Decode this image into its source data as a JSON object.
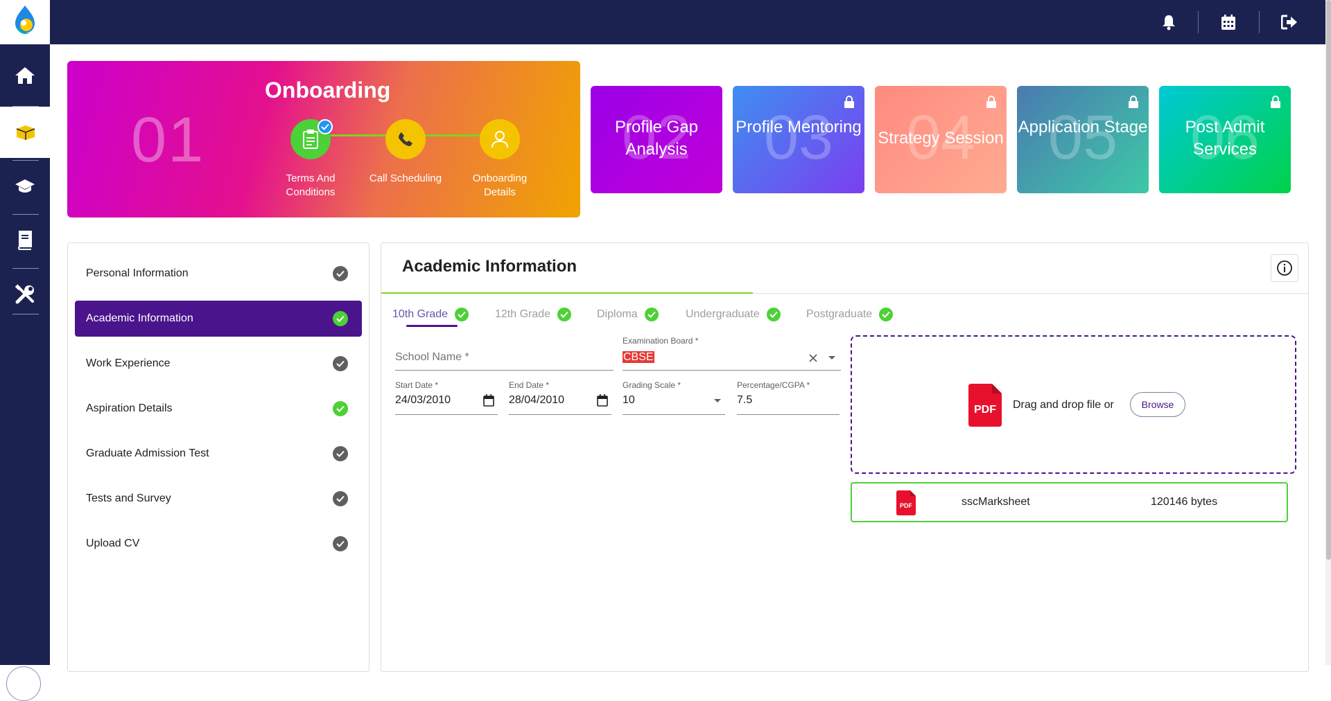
{
  "topbar": {
    "icons": [
      "bell-icon",
      "calendar-icon",
      "logout-icon"
    ]
  },
  "sidebar": {
    "items": [
      "home-icon",
      "onboarding-box-icon",
      "graduation-cap-icon",
      "book-icon",
      "tools-icon"
    ],
    "active_index": 1,
    "expand_icon": "chevron-right-icon"
  },
  "onboarding": {
    "number": "01",
    "title": "Onboarding",
    "steps": [
      {
        "label": "Terms And Conditions",
        "icon": "clipboard-icon",
        "done": true
      },
      {
        "label": "Call Scheduling",
        "icon": "phone-icon",
        "done": false
      },
      {
        "label": "Onboarding Details",
        "icon": "user-icon",
        "done": false
      }
    ],
    "colors": {
      "step1": "#4cd137",
      "step2": "#f5c400",
      "step3": "#f5c400",
      "connector": "#7ed321"
    }
  },
  "stages": [
    {
      "num": "02",
      "label": "Profile Gap Analysis",
      "locked": false
    },
    {
      "num": "03",
      "label": "Profile Mentoring",
      "locked": true
    },
    {
      "num": "04",
      "label": "Strategy Session",
      "locked": true
    },
    {
      "num": "05",
      "label": "Application Stage",
      "locked": true
    },
    {
      "num": "06",
      "label": "Post Admit Services",
      "locked": true
    }
  ],
  "nav": {
    "items": [
      {
        "label": "Personal Information",
        "status": "complete-grey"
      },
      {
        "label": "Academic Information",
        "status": "complete-green"
      },
      {
        "label": "Work Experience",
        "status": "complete-grey"
      },
      {
        "label": "Aspiration Details",
        "status": "complete-green"
      },
      {
        "label": "Graduate Admission Test",
        "status": "complete-grey"
      },
      {
        "label": "Tests and Survey",
        "status": "complete-grey"
      },
      {
        "label": "Upload CV",
        "status": "complete-grey"
      }
    ],
    "active_index": 1
  },
  "main": {
    "title": "Academic Information",
    "info_icon": "info-icon",
    "tabs": [
      "10th Grade",
      "12th Grade",
      "Diploma",
      "Undergraduate",
      "Postgraduate"
    ],
    "active_tab": 0,
    "form": {
      "school_name_placeholder": "School Name *",
      "exam_board_label": "Examination Board *",
      "exam_board_value": "CBSE",
      "start_date_label": "Start Date *",
      "start_date_value": "24/03/2010",
      "end_date_label": "End Date *",
      "end_date_value": "28/04/2010",
      "grading_scale_label": "Grading Scale *",
      "grading_scale_value": "10",
      "percentage_label": "Percentage/CGPA *",
      "percentage_value": "7.5"
    },
    "upload": {
      "drop_text": "Drag and drop file or",
      "browse_label": "Browse",
      "pdf_badge": "PDF",
      "file_name": "sscMarksheet",
      "file_size": "120146 bytes"
    }
  }
}
